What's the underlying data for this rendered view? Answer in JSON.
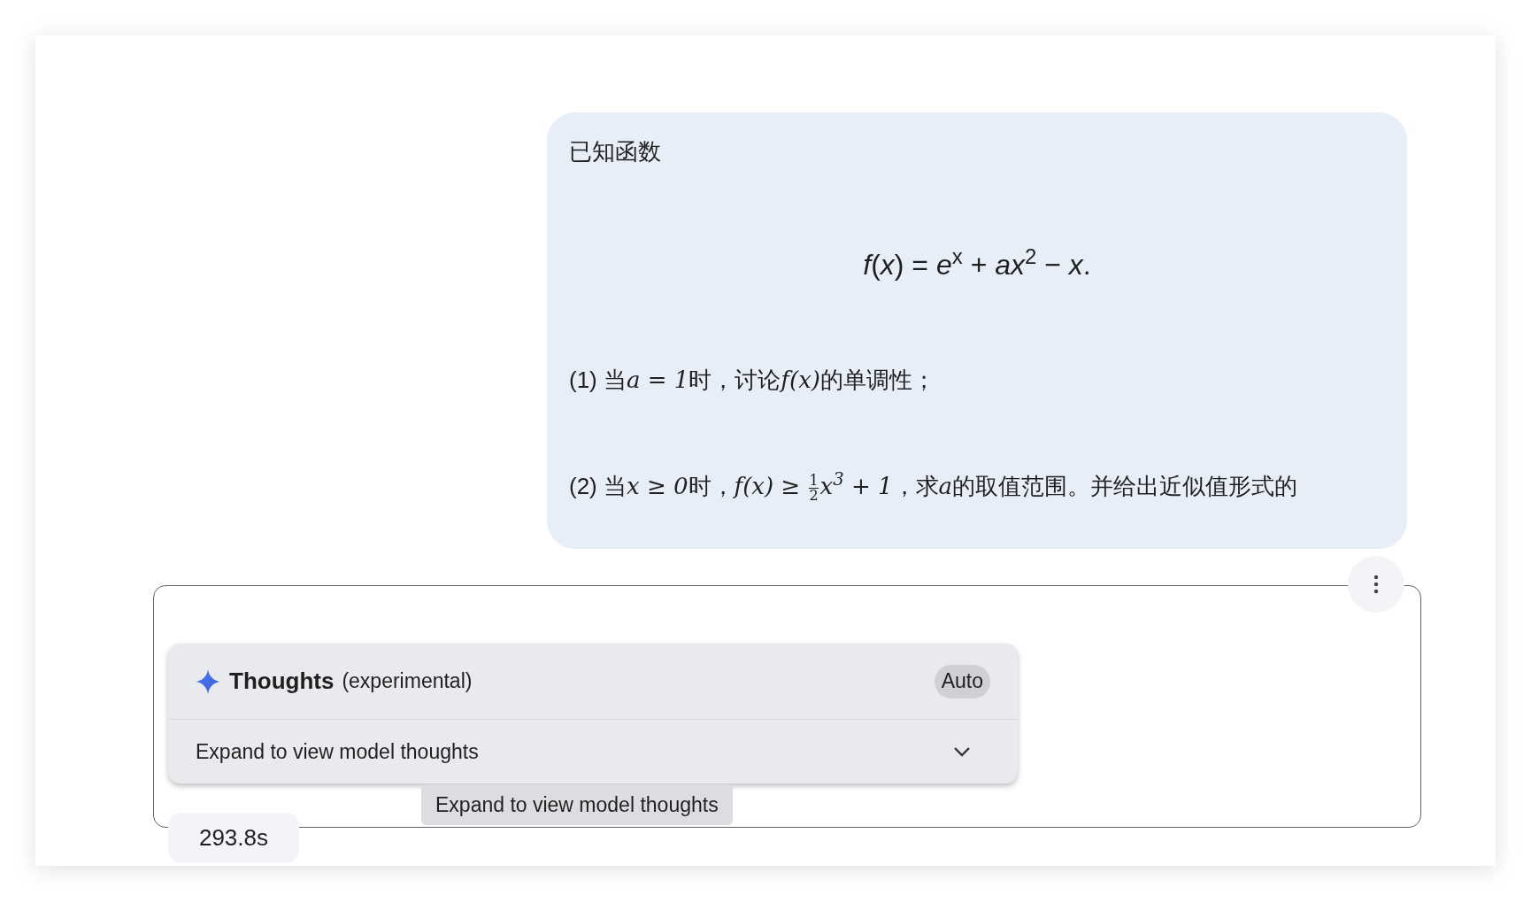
{
  "prompt": {
    "heading": "已知函数",
    "formula": "*f*(*x*) = *e*$^{x}$ + *ax*$^{2}$ − *x*.",
    "questions": [
      {
        "parts": [
          {
            "kind": "text",
            "s": "(1) 当"
          },
          {
            "kind": "math",
            "s": "a = 1"
          },
          {
            "kind": "text",
            "s": "时，讨论"
          },
          {
            "kind": "math",
            "s": "f(x)"
          },
          {
            "kind": "text",
            "s": "的单调性；"
          }
        ]
      },
      {
        "parts": [
          {
            "kind": "text",
            "s": "(2) 当"
          },
          {
            "kind": "math",
            "s": "x ≥ 0"
          },
          {
            "kind": "text",
            "s": "时，"
          },
          {
            "kind": "math",
            "s": "f(x) ≥ "
          },
          {
            "kind": "frac",
            "num": "1",
            "den": "2"
          },
          {
            "kind": "math",
            "s": "x$^{3}$ + 1"
          },
          {
            "kind": "text",
            "s": "，求"
          },
          {
            "kind": "math",
            "s": "a"
          },
          {
            "kind": "text",
            "s": "的取值范围。并给出近似值形式的"
          }
        ]
      }
    ]
  },
  "response": {
    "thoughts": {
      "title": "Thoughts",
      "subtitle": "(experimental)",
      "mode": "Auto",
      "expand_label": "Expand to view model thoughts",
      "expanded": false
    },
    "tooltip": "Expand to view model thoughts",
    "duration": "293.8s"
  }
}
